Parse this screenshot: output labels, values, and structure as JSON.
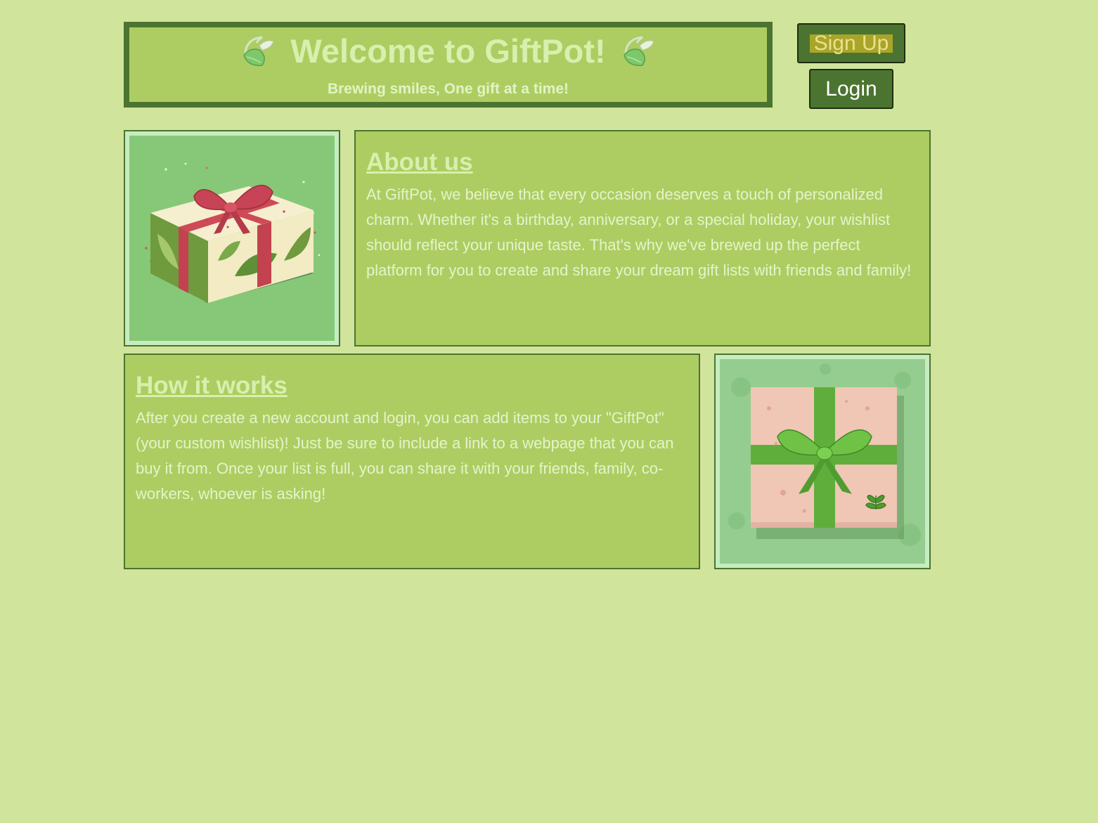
{
  "header": {
    "title": "Welcome to GiftPot!",
    "subtitle": "Brewing smiles, One gift at a time!",
    "left_icon": "leaf-icon",
    "right_icon": "leaf-icon"
  },
  "auth": {
    "signup_label": "Sign Up",
    "login_label": "Login"
  },
  "about": {
    "heading": "About us",
    "body": "At GiftPot, we believe that every occasion deserves a touch of personalized charm. Whether it's a birthday, anniversary, or a special holiday, your wishlist should reflect your unique taste. That's why we've brewed up the perfect platform for you to create and share your dream gift lists with friends and family!",
    "image": "gift-box-red-ribbon-illustration"
  },
  "how": {
    "heading": "How it works",
    "body": "After you create a new account and login, you can add items to your \"GiftPot\" (your custom wishlist)! Just be sure to include a link to a webpage that you can buy it from. Once your list is full, you can share it with your friends, family, co-workers, whoever is asking!",
    "image": "gift-box-green-ribbon-illustration"
  },
  "colors": {
    "background": "#d1e49c",
    "panel": "#adcd62",
    "border": "#4b7430",
    "text_light": "#d7f0ad"
  }
}
